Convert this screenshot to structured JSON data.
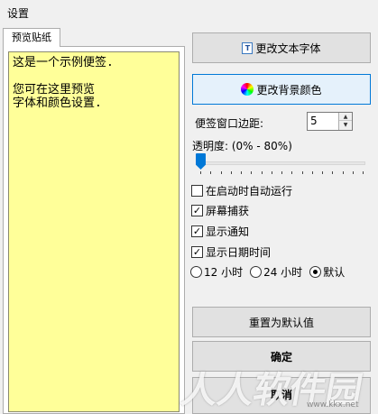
{
  "window": {
    "title": "设置"
  },
  "preview": {
    "tab_label": "预览贴纸",
    "note_lines": [
      "这是一个示例便签.",
      "",
      "您可在这里预览",
      "字体和颜色设置."
    ],
    "note_bg": "#ffff99"
  },
  "buttons": {
    "change_font": "更改文本字体",
    "change_bg": "更改背景颜色",
    "reset": "重置为默认值",
    "ok": "确定",
    "cancel": "取消"
  },
  "margin": {
    "label": "便签窗口边距:",
    "value": "5"
  },
  "opacity": {
    "label": "透明度: (0% - 80%)",
    "value_percent": 0
  },
  "checkboxes": [
    {
      "label": "在启动时自动运行",
      "checked": false
    },
    {
      "label": "屏幕捕获",
      "checked": true
    },
    {
      "label": "显示通知",
      "checked": true
    },
    {
      "label": "显示日期时间",
      "checked": true
    }
  ],
  "time_format": {
    "options": [
      "12 小时",
      "24 小时",
      "默认"
    ],
    "selected": "默认"
  },
  "watermark": {
    "text": "人人软件园",
    "url": "www.kkx.net"
  },
  "colors": {
    "accent": "#0078d7",
    "button_bg": "#e1e1e1",
    "focused_bg": "#e5f1fb"
  }
}
